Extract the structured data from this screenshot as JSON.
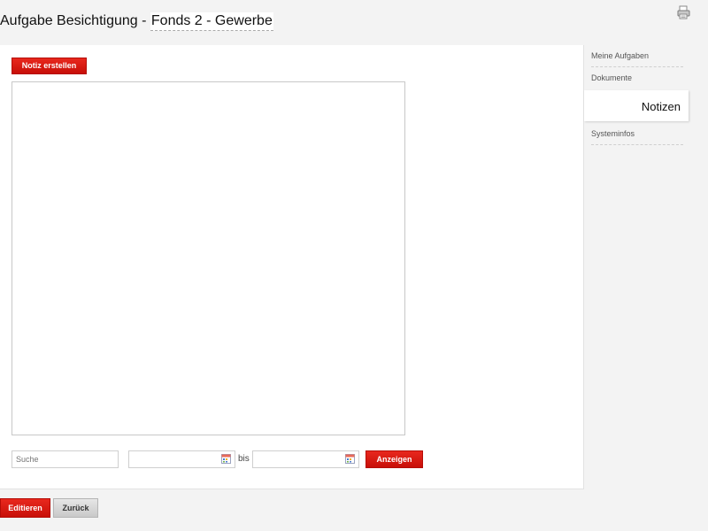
{
  "header": {
    "title_prefix": "Aufgabe Besichtigung - ",
    "title_link": "Fonds 2 - Gewerbe",
    "print_icon": "printer-icon"
  },
  "notes": {
    "create_button": "Notiz erstellen"
  },
  "filter": {
    "search_placeholder": "Suche",
    "date_from": "",
    "date_to": "",
    "between_label": "bis",
    "show_button": "Anzeigen",
    "calendar_icon": "calendar-icon"
  },
  "sidebar": {
    "items": [
      {
        "label": "Meine Aufgaben"
      },
      {
        "label": "Dokumente"
      },
      {
        "label": "Notizen",
        "active": true
      },
      {
        "label": "Systeminfos"
      }
    ]
  },
  "footer": {
    "edit_button": "Editieren",
    "back_button": "Zurück"
  },
  "colors": {
    "accent": "#d81b12",
    "background": "#f3f3f3",
    "panel": "#ffffff"
  }
}
